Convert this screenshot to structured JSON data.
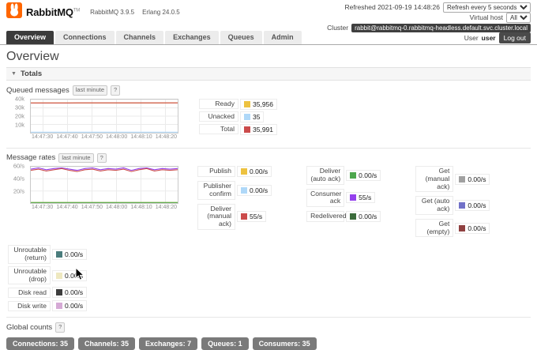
{
  "header": {
    "product": "RabbitMQ",
    "tm": "TM",
    "version": "RabbitMQ 3.9.5",
    "erlang": "Erlang 24.0.5",
    "refreshed": "Refreshed 2021-09-19 14:48:26",
    "refresh_interval": "Refresh every 5 seconds",
    "virtual_host_label": "Virtual host",
    "virtual_host_value": "All",
    "cluster_label": "Cluster",
    "cluster_name": "rabbit@rabbitmq-0.rabbitmq-headless.default.svc.cluster.local",
    "user_label": "User",
    "user_name": "user",
    "logout_label": "Log out"
  },
  "nav": {
    "tabs": [
      {
        "label": "Overview"
      },
      {
        "label": "Connections"
      },
      {
        "label": "Channels"
      },
      {
        "label": "Exchanges"
      },
      {
        "label": "Queues"
      },
      {
        "label": "Admin"
      }
    ]
  },
  "page": {
    "title": "Overview",
    "totals_section": "Totals",
    "collapse_arrow": "▼",
    "last_minute_badge": "last minute",
    "help_badge": "?",
    "global_counts_label": "Global counts"
  },
  "queued": {
    "title": "Queued messages",
    "legend": [
      {
        "label": "Ready",
        "value": "35,956",
        "color": "#edc240"
      },
      {
        "label": "Unacked",
        "value": "35",
        "color": "#afd8f8"
      },
      {
        "label": "Total",
        "value": "35,991",
        "color": "#cb4b4b"
      }
    ]
  },
  "rates": {
    "title": "Message rates",
    "columns": [
      [
        {
          "label": "Publish",
          "value": "0.00/s",
          "color": "#edc240"
        },
        {
          "label": "Publisher confirm",
          "value": "0.00/s",
          "color": "#afd8f8"
        },
        {
          "label": "Deliver (manual ack)",
          "value": "55/s",
          "color": "#cb4b4b"
        }
      ],
      [
        {
          "label": "Deliver (auto ack)",
          "value": "0.00/s",
          "color": "#4da74d"
        },
        {
          "label": "Consumer ack",
          "value": "55/s",
          "color": "#9440ed"
        },
        {
          "label": "Redelivered",
          "value": "0.00/s",
          "color": "#3b6b3b"
        }
      ],
      [
        {
          "label": "Get (manual ack)",
          "value": "0.00/s",
          "color": "#a0a0a0"
        },
        {
          "label": "Get (auto ack)",
          "value": "0.00/s",
          "color": "#7171c8"
        },
        {
          "label": "Get (empty)",
          "value": "0.00/s",
          "color": "#8f4040"
        }
      ]
    ],
    "extras": [
      {
        "label": "Unroutable (return)",
        "value": "0.00/s",
        "color": "#4a7c7c"
      },
      {
        "label": "Unroutable (drop)",
        "value": "0.00/s",
        "color": "#eee8c0"
      },
      {
        "label": "Disk read",
        "value": "0.00/s",
        "color": "#3d3d3d"
      },
      {
        "label": "Disk write",
        "value": "0.00/s",
        "color": "#d5aad5"
      }
    ]
  },
  "counts": [
    {
      "label": "Connections: 35"
    },
    {
      "label": "Channels: 35"
    },
    {
      "label": "Exchanges: 7"
    },
    {
      "label": "Queues: 1"
    },
    {
      "label": "Consumers: 35"
    }
  ],
  "chart_data": [
    {
      "type": "line",
      "title": "Queued messages (last minute)",
      "x_ticks": [
        "14:47:30",
        "14:47:40",
        "14:47:50",
        "14:48:00",
        "14:48:10",
        "14:48:20"
      ],
      "ylim": [
        0,
        40000
      ],
      "y_ticks": [
        {
          "v": 40000,
          "label": "40k"
        },
        {
          "v": 30000,
          "label": "30k"
        },
        {
          "v": 20000,
          "label": "20k"
        },
        {
          "v": 10000,
          "label": "10k"
        }
      ],
      "series": [
        {
          "name": "Unacked",
          "color": "#afd8f8",
          "values": [
            35,
            35,
            35,
            35,
            35,
            35,
            35,
            35,
            35,
            35,
            35,
            35,
            35,
            35,
            35,
            35,
            35,
            35,
            35,
            35
          ]
        },
        {
          "name": "Ready",
          "color": "#edc240",
          "values": [
            35900,
            35903,
            35906,
            35909,
            35912,
            35915,
            35918,
            35921,
            35924,
            35927,
            35930,
            35933,
            35936,
            35939,
            35942,
            35945,
            35948,
            35950,
            35953,
            35956
          ]
        },
        {
          "name": "Total",
          "color": "#cb4b4b",
          "values": [
            35935,
            35938,
            35941,
            35944,
            35947,
            35950,
            35953,
            35956,
            35959,
            35962,
            35965,
            35968,
            35971,
            35974,
            35977,
            35980,
            35983,
            35985,
            35988,
            35991
          ]
        }
      ]
    },
    {
      "type": "line",
      "title": "Message rates (last minute)",
      "x_ticks": [
        "14:47:30",
        "14:47:40",
        "14:47:50",
        "14:48:00",
        "14:48:10",
        "14:48:20"
      ],
      "ylim": [
        0,
        60
      ],
      "y_ticks": [
        {
          "v": 60,
          "label": "60/s"
        },
        {
          "v": 40,
          "label": "40/s"
        },
        {
          "v": 20,
          "label": "20/s"
        }
      ],
      "series": [
        {
          "name": "Publish",
          "color": "#edc240",
          "values": [
            0,
            0,
            0,
            0,
            0,
            0,
            0,
            0,
            0,
            0,
            0,
            0,
            0,
            0,
            0,
            0,
            0,
            0,
            0,
            0
          ]
        },
        {
          "name": "Deliver (auto ack)",
          "color": "#4da74d",
          "values": [
            0,
            0,
            0,
            0,
            0,
            0,
            0,
            0,
            0,
            0,
            0,
            0,
            0,
            0,
            0,
            0,
            0,
            0,
            0,
            0
          ]
        },
        {
          "name": "Consumer ack",
          "color": "#9440ed",
          "values": [
            56,
            58,
            55,
            57,
            58,
            56,
            54,
            57,
            58,
            55,
            57,
            56,
            58,
            54,
            57,
            58,
            55,
            57,
            56,
            57
          ]
        },
        {
          "name": "Deliver (manual ack)",
          "color": "#cb4b4b",
          "values": [
            54,
            56,
            53,
            55,
            57,
            54,
            52,
            55,
            56,
            53,
            55,
            54,
            56,
            52,
            55,
            57,
            53,
            55,
            54,
            55
          ]
        }
      ]
    }
  ]
}
